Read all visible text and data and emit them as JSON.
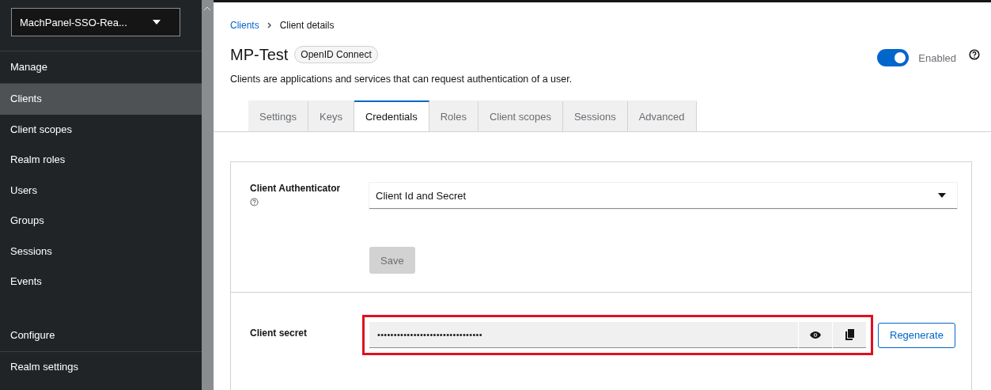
{
  "realm_selector": {
    "label": "MachPanel-SSO-Rea..."
  },
  "sidebar": {
    "sections": [
      {
        "heading": "Manage",
        "items": [
          {
            "label": "Clients",
            "selected": true
          },
          {
            "label": "Client scopes",
            "selected": false
          },
          {
            "label": "Realm roles",
            "selected": false
          },
          {
            "label": "Users",
            "selected": false
          },
          {
            "label": "Groups",
            "selected": false
          },
          {
            "label": "Sessions",
            "selected": false
          },
          {
            "label": "Events",
            "selected": false
          }
        ]
      },
      {
        "heading": "Configure",
        "items": [
          {
            "label": "Realm settings",
            "selected": false
          }
        ]
      }
    ]
  },
  "breadcrumb": [
    {
      "label": "Clients",
      "kind": "link"
    },
    {
      "label": "Client details",
      "kind": "current"
    }
  ],
  "header": {
    "title": "MP-Test",
    "badge": "OpenID Connect",
    "description": "Clients are applications and services that can request authentication of a user.",
    "toggle": {
      "label": "Enabled",
      "on": true
    }
  },
  "tabs": [
    {
      "label": "Settings",
      "selected": false
    },
    {
      "label": "Keys",
      "selected": false
    },
    {
      "label": "Credentials",
      "selected": true
    },
    {
      "label": "Roles",
      "selected": false
    },
    {
      "label": "Client scopes",
      "selected": false
    },
    {
      "label": "Sessions",
      "selected": false
    },
    {
      "label": "Advanced",
      "selected": false
    }
  ],
  "form": {
    "authenticator": {
      "label": "Client Authenticator",
      "value": "Client Id and Secret"
    },
    "save": {
      "label": "Save",
      "disabled": true
    },
    "secret": {
      "label": "Client secret",
      "value": "••••••••••••••••••••••••••••••••",
      "highlighted": true
    },
    "regenerate": {
      "label": "Regenerate"
    }
  }
}
